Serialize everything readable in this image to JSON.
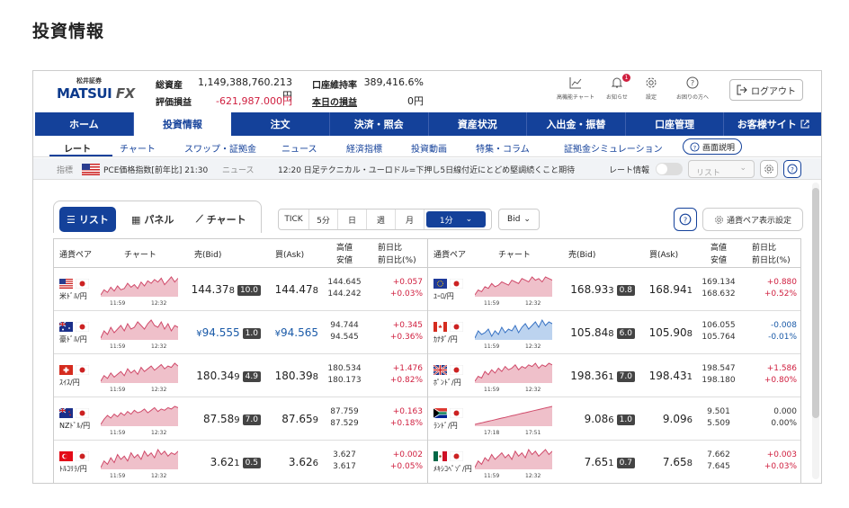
{
  "page_title": "投資情報",
  "logo": {
    "small": "松井証券",
    "main": "MATSUI",
    "fx": "FX"
  },
  "stats": {
    "total_assets_label": "総資産",
    "total_assets_value": "1,149,388,760.213円",
    "unrealized_label": "評価損益",
    "unrealized_value": "-621,987.000円",
    "margin_label": "口座維持率",
    "margin_value": "389,416.6%",
    "today_pl_label": "本日の損益",
    "today_pl_value": "0円"
  },
  "toolbar": {
    "multichart": "高機能チャート",
    "notices": "お知らせ",
    "notice_badge": "1",
    "settings": "設定",
    "help": "お困りの方へ",
    "logout": "ログアウト"
  },
  "nav": [
    "ホーム",
    "投資情報",
    "注文",
    "決済・照会",
    "資産状況",
    "入出金・振替",
    "口座管理",
    "お客様サイト"
  ],
  "subnav": [
    "レート",
    "チャート",
    "スワップ・証拠金",
    "ニュース",
    "経済指標",
    "投資動画",
    "特集・コラム",
    "証拠金シミュレーション"
  ],
  "help_button": "画面説明",
  "info_bar": {
    "indicator_label": "指標",
    "indicator_text": "PCE価格指数[前年比] 21:30",
    "news_label": "ニュース",
    "news_text": "12:20 日足テクニカル・ユーロドル=下押し5日線付近にとどめ堅調続くこと期待",
    "rate_label": "レート情報",
    "select_value": "リスト"
  },
  "view_tabs": [
    "リスト",
    "パネル",
    "チャート"
  ],
  "intervals": [
    "TICK",
    "5分",
    "日",
    "週",
    "月",
    "1分"
  ],
  "price_type": "Bid",
  "pair_settings": "通貨ペア表示設定",
  "headers": {
    "pair": "通貨ペア",
    "chart": "チャート",
    "bid": "売(Bid)",
    "ask": "買(Ask)",
    "high": "高値",
    "low": "安値",
    "chg": "前日比",
    "chg_pct": "前日比(%)"
  },
  "colors": {
    "primary": "#14419a",
    "up": "#d02040",
    "down": "#1a5aa8"
  },
  "left": [
    {
      "pair": "米ﾄﾞﾙ/円",
      "flag": "us",
      "t1": "11:59",
      "t2": "12:32",
      "bid_main": "144.37",
      "bid_last": "8",
      "spread": "10.0",
      "ask_main": "144.47",
      "ask_last": "8",
      "high": "144.645",
      "low": "144.242",
      "chg": "+0.057",
      "pct": "+0.03%",
      "dir": "up",
      "chart": [
        5,
        9,
        7,
        11,
        8,
        12,
        9,
        10,
        14,
        11,
        13,
        10,
        15,
        12,
        16,
        14,
        17,
        15,
        18,
        13,
        16,
        19,
        15,
        18
      ]
    },
    {
      "pair": "豪ﾄﾞﾙ/円",
      "flag": "au",
      "t1": "11:59",
      "t2": "12:32",
      "bid_prefix": "¥",
      "bid_main": "94.555",
      "bid_last": "",
      "spread": "1.0",
      "ask_prefix": "¥",
      "ask_main": "94.565",
      "ask_last": "",
      "high": "94.744",
      "low": "94.545",
      "chg": "+0.345",
      "pct": "+0.36%",
      "dir": "up",
      "bid_blue": true,
      "chart": [
        8,
        12,
        10,
        14,
        11,
        13,
        15,
        12,
        16,
        13,
        14,
        17,
        15,
        13,
        16,
        18,
        15,
        14,
        17,
        13,
        16,
        12,
        15,
        14
      ]
    },
    {
      "pair": "ｽｲｽ/円",
      "flag": "ch",
      "t1": "11:59",
      "t2": "12:32",
      "bid_main": "180.34",
      "bid_last": "9",
      "spread": "4.9",
      "ask_main": "180.39",
      "ask_last": "8",
      "high": "180.534",
      "low": "180.173",
      "chg": "+1.476",
      "pct": "+0.82%",
      "dir": "up",
      "chart": [
        6,
        10,
        8,
        12,
        9,
        11,
        13,
        10,
        15,
        12,
        14,
        11,
        16,
        13,
        15,
        17,
        14,
        16,
        18,
        15,
        17,
        16,
        19,
        17
      ]
    },
    {
      "pair": "NZﾄﾞﾙ/円",
      "flag": "nz",
      "t1": "11:59",
      "t2": "12:32",
      "bid_main": "87.58",
      "bid_last": "9",
      "spread": "7.0",
      "ask_main": "87.65",
      "ask_last": "9",
      "high": "87.759",
      "low": "87.529",
      "chg": "+0.163",
      "pct": "+0.18%",
      "dir": "up",
      "chart": [
        5,
        9,
        12,
        10,
        13,
        11,
        14,
        12,
        15,
        13,
        16,
        14,
        15,
        17,
        14,
        16,
        18,
        15,
        17,
        16,
        18,
        17,
        19,
        18
      ]
    },
    {
      "pair": "ﾄﾙｺﾘﾗ/円",
      "flag": "tr",
      "t1": "11:59",
      "t2": "12:32",
      "bid_main": "3.62",
      "bid_last": "1",
      "spread": "0.5",
      "ask_main": "3.62",
      "ask_last": "6",
      "high": "3.627",
      "low": "3.617",
      "chg": "+0.002",
      "pct": "+0.05%",
      "dir": "up",
      "chart": [
        7,
        11,
        9,
        13,
        10,
        15,
        12,
        14,
        11,
        16,
        13,
        15,
        12,
        17,
        14,
        16,
        13,
        18,
        15,
        17,
        14,
        16,
        15,
        17
      ]
    }
  ],
  "right": [
    {
      "pair": "ﾕｰﾛ/円",
      "flag": "eu",
      "t1": "11:59",
      "t2": "12:32",
      "bid_main": "168.93",
      "bid_last": "3",
      "spread": "0.8",
      "ask_main": "168.94",
      "ask_last": "1",
      "high": "169.134",
      "low": "168.632",
      "chg": "+0.880",
      "pct": "+0.52%",
      "dir": "up",
      "chart": [
        6,
        9,
        8,
        11,
        10,
        13,
        11,
        12,
        14,
        13,
        12,
        15,
        14,
        13,
        16,
        15,
        14,
        17,
        15,
        16,
        14,
        17,
        16,
        15
      ]
    },
    {
      "pair": "ｶﾅﾀﾞ/円",
      "flag": "ca",
      "t1": "11:59",
      "t2": "12:32",
      "bid_main": "105.84",
      "bid_last": "8",
      "spread": "6.0",
      "ask_main": "105.90",
      "ask_last": "8",
      "high": "106.055",
      "low": "105.764",
      "chg": "-0.008",
      "pct": "-0.01%",
      "dir": "down",
      "chart": [
        8,
        12,
        10,
        11,
        13,
        9,
        12,
        10,
        14,
        11,
        13,
        12,
        15,
        11,
        14,
        16,
        13,
        15,
        17,
        14,
        18,
        15,
        17,
        16
      ]
    },
    {
      "pair": "ﾎﾟﾝﾄﾞ/円",
      "flag": "gb",
      "t1": "11:59",
      "t2": "12:32",
      "bid_main": "198.36",
      "bid_last": "1",
      "spread": "7.0",
      "ask_main": "198.43",
      "ask_last": "1",
      "high": "198.547",
      "low": "198.180",
      "chg": "+1.586",
      "pct": "+0.80%",
      "dir": "up",
      "chart": [
        7,
        10,
        9,
        13,
        11,
        14,
        12,
        15,
        13,
        16,
        14,
        15,
        17,
        14,
        16,
        15,
        17,
        16,
        18,
        15,
        17,
        16,
        18,
        17
      ]
    },
    {
      "pair": "ﾗﾝﾄﾞ/円",
      "flag": "za",
      "t1": "17:18",
      "t2": "17:51",
      "bid_main": "9.08",
      "bid_last": "6",
      "spread": "1.0",
      "ask_main": "9.09",
      "ask_last": "6",
      "high": "9.501",
      "low": "5.509",
      "chg": "0.000",
      "pct": "0.00%",
      "dir": "zero",
      "chart": [
        1,
        2,
        3,
        4,
        5,
        6,
        7,
        8,
        9,
        10,
        11,
        12,
        13,
        14,
        15,
        16,
        17,
        18,
        19,
        20,
        21,
        22,
        23,
        24
      ]
    },
    {
      "pair": "ﾒｷｼｺﾍﾟｿﾞ/円",
      "flag": "mx",
      "t1": "11:59",
      "t2": "12:32",
      "bid_main": "7.65",
      "bid_last": "1",
      "spread": "0.7",
      "ask_main": "7.65",
      "ask_last": "8",
      "high": "7.662",
      "low": "7.645",
      "chg": "+0.003",
      "pct": "+0.03%",
      "dir": "up",
      "chart": [
        6,
        10,
        8,
        12,
        10,
        14,
        11,
        13,
        15,
        12,
        14,
        11,
        16,
        13,
        15,
        12,
        17,
        14,
        16,
        13,
        15,
        17,
        14,
        16
      ]
    }
  ]
}
